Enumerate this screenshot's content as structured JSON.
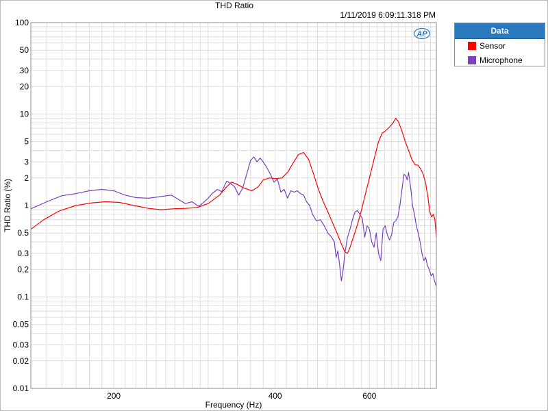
{
  "window": {
    "title": "THD Ratio",
    "timestamp": "1/11/2019 6:09:11.318 PM"
  },
  "logo": {
    "text": "AP"
  },
  "legend": {
    "header": "Data",
    "items": [
      {
        "label": "Sensor",
        "color": "#ff0000"
      },
      {
        "label": "Microphone",
        "color": "#7b3fbf"
      }
    ]
  },
  "colors": {
    "grid": "#dcdcdc",
    "axis_border": "#8c8c8c",
    "legend_header": "#2b79bd",
    "logo_blue": "#2b79bd"
  },
  "chart_data": {
    "type": "line",
    "title": "THD Ratio",
    "xlabel": "Frequency (Hz)",
    "ylabel": "THD Ratio (%)",
    "x_scale": "log",
    "y_scale": "log",
    "xlim": [
      140,
      800
    ],
    "ylim": [
      0.01,
      100
    ],
    "grid": true,
    "legend_position": "right",
    "x_ticks": [
      200,
      400,
      600
    ],
    "x_tick_labels": [
      "200",
      "400",
      "600"
    ],
    "x_minor_ticks": [
      150,
      160,
      170,
      180,
      190,
      210,
      220,
      230,
      240,
      250,
      260,
      270,
      280,
      290,
      300,
      320,
      340,
      360,
      380,
      420,
      440,
      460,
      480,
      500,
      520,
      540,
      560,
      580,
      620,
      640,
      660,
      680,
      700,
      720,
      740,
      760,
      780,
      800
    ],
    "y_ticks": [
      0.01,
      0.02,
      0.03,
      0.05,
      0.1,
      0.2,
      0.3,
      0.5,
      1,
      2,
      3,
      5,
      10,
      20,
      30,
      50,
      100
    ],
    "y_tick_labels": [
      "0.01",
      "0.02",
      "0.03",
      "0.05",
      "0.1",
      "0.2",
      "0.3",
      "0.5",
      "1",
      "2",
      "3",
      "5",
      "10",
      "20",
      "30",
      "50",
      "100"
    ],
    "y_minor_ticks": [
      0.04,
      0.06,
      0.07,
      0.08,
      0.09,
      0.4,
      0.6,
      0.7,
      0.8,
      0.9,
      4,
      6,
      7,
      8,
      9,
      40,
      60,
      70,
      80,
      90
    ],
    "series": [
      {
        "name": "Sensor",
        "color": "#ff0000",
        "points": [
          [
            140,
            0.55
          ],
          [
            148,
            0.7
          ],
          [
            158,
            0.87
          ],
          [
            170,
            1.0
          ],
          [
            182,
            1.07
          ],
          [
            193,
            1.1
          ],
          [
            205,
            1.08
          ],
          [
            218,
            1.0
          ],
          [
            232,
            0.93
          ],
          [
            245,
            0.9
          ],
          [
            258,
            0.92
          ],
          [
            272,
            0.93
          ],
          [
            286,
            0.95
          ],
          [
            300,
            1.05
          ],
          [
            315,
            1.3
          ],
          [
            325,
            1.6
          ],
          [
            332,
            1.8
          ],
          [
            340,
            1.7
          ],
          [
            350,
            1.55
          ],
          [
            362,
            1.45
          ],
          [
            372,
            1.6
          ],
          [
            380,
            1.9
          ],
          [
            390,
            2.0
          ],
          [
            400,
            1.97
          ],
          [
            412,
            2.0
          ],
          [
            422,
            2.3
          ],
          [
            432,
            2.9
          ],
          [
            442,
            3.6
          ],
          [
            452,
            3.8
          ],
          [
            462,
            3.2
          ],
          [
            472,
            2.2
          ],
          [
            482,
            1.5
          ],
          [
            492,
            1.1
          ],
          [
            502,
            0.85
          ],
          [
            512,
            0.65
          ],
          [
            522,
            0.5
          ],
          [
            532,
            0.38
          ],
          [
            540,
            0.31
          ],
          [
            546,
            0.3
          ],
          [
            552,
            0.35
          ],
          [
            560,
            0.45
          ],
          [
            570,
            0.62
          ],
          [
            580,
            0.9
          ],
          [
            590,
            1.35
          ],
          [
            600,
            2.0
          ],
          [
            612,
            3.2
          ],
          [
            624,
            5.0
          ],
          [
            634,
            6.2
          ],
          [
            644,
            6.6
          ],
          [
            654,
            7.2
          ],
          [
            664,
            8.0
          ],
          [
            672,
            9.0
          ],
          [
            680,
            8.2
          ],
          [
            690,
            6.5
          ],
          [
            700,
            5.0
          ],
          [
            710,
            4.0
          ],
          [
            720,
            3.2
          ],
          [
            730,
            2.8
          ],
          [
            740,
            2.75
          ],
          [
            748,
            2.5
          ],
          [
            756,
            2.2
          ],
          [
            764,
            1.75
          ],
          [
            772,
            1.2
          ],
          [
            778,
            0.85
          ],
          [
            784,
            0.75
          ],
          [
            790,
            0.8
          ],
          [
            795,
            0.7
          ],
          [
            800,
            0.45
          ]
        ]
      },
      {
        "name": "Microphone",
        "color": "#7b3fbf",
        "points": [
          [
            140,
            0.92
          ],
          [
            150,
            1.1
          ],
          [
            160,
            1.28
          ],
          [
            170,
            1.35
          ],
          [
            180,
            1.45
          ],
          [
            190,
            1.5
          ],
          [
            200,
            1.45
          ],
          [
            210,
            1.3
          ],
          [
            220,
            1.22
          ],
          [
            232,
            1.2
          ],
          [
            244,
            1.25
          ],
          [
            256,
            1.3
          ],
          [
            265,
            1.15
          ],
          [
            272,
            1.05
          ],
          [
            280,
            1.1
          ],
          [
            288,
            0.98
          ],
          [
            294,
            1.08
          ],
          [
            300,
            1.2
          ],
          [
            305,
            1.35
          ],
          [
            312,
            1.5
          ],
          [
            318,
            1.42
          ],
          [
            325,
            1.85
          ],
          [
            330,
            1.75
          ],
          [
            336,
            1.6
          ],
          [
            342,
            1.3
          ],
          [
            348,
            1.55
          ],
          [
            354,
            2.2
          ],
          [
            360,
            3.1
          ],
          [
            365,
            3.4
          ],
          [
            370,
            3.0
          ],
          [
            375,
            3.3
          ],
          [
            380,
            3.0
          ],
          [
            386,
            2.6
          ],
          [
            392,
            2.2
          ],
          [
            398,
            1.8
          ],
          [
            404,
            1.95
          ],
          [
            410,
            1.4
          ],
          [
            416,
            1.5
          ],
          [
            422,
            1.2
          ],
          [
            428,
            1.45
          ],
          [
            434,
            1.4
          ],
          [
            440,
            1.45
          ],
          [
            446,
            1.35
          ],
          [
            452,
            1.3
          ],
          [
            458,
            1.1
          ],
          [
            464,
            1.0
          ],
          [
            470,
            0.8
          ],
          [
            478,
            0.68
          ],
          [
            486,
            0.7
          ],
          [
            494,
            0.6
          ],
          [
            502,
            0.5
          ],
          [
            510,
            0.45
          ],
          [
            516,
            0.4
          ],
          [
            520,
            0.27
          ],
          [
            524,
            0.32
          ],
          [
            528,
            0.22
          ],
          [
            532,
            0.15
          ],
          [
            536,
            0.2
          ],
          [
            540,
            0.3
          ],
          [
            546,
            0.45
          ],
          [
            552,
            0.55
          ],
          [
            558,
            0.7
          ],
          [
            564,
            0.85
          ],
          [
            570,
            0.88
          ],
          [
            576,
            0.8
          ],
          [
            582,
            0.72
          ],
          [
            588,
            0.45
          ],
          [
            594,
            0.6
          ],
          [
            600,
            0.55
          ],
          [
            606,
            0.4
          ],
          [
            612,
            0.35
          ],
          [
            618,
            0.5
          ],
          [
            624,
            0.3
          ],
          [
            630,
            0.25
          ],
          [
            636,
            0.55
          ],
          [
            642,
            0.6
          ],
          [
            648,
            0.48
          ],
          [
            654,
            0.42
          ],
          [
            660,
            0.48
          ],
          [
            666,
            0.65
          ],
          [
            672,
            0.68
          ],
          [
            678,
            0.75
          ],
          [
            684,
            1.0
          ],
          [
            690,
            1.5
          ],
          [
            696,
            2.2
          ],
          [
            702,
            2.1
          ],
          [
            706,
            1.9
          ],
          [
            710,
            2.3
          ],
          [
            714,
            1.8
          ],
          [
            718,
            1.4
          ],
          [
            722,
            1.0
          ],
          [
            728,
            0.8
          ],
          [
            734,
            0.6
          ],
          [
            740,
            0.5
          ],
          [
            746,
            0.4
          ],
          [
            752,
            0.3
          ],
          [
            758,
            0.25
          ],
          [
            764,
            0.27
          ],
          [
            770,
            0.22
          ],
          [
            776,
            0.2
          ],
          [
            782,
            0.17
          ],
          [
            788,
            0.18
          ],
          [
            794,
            0.15
          ],
          [
            800,
            0.13
          ]
        ]
      }
    ]
  }
}
